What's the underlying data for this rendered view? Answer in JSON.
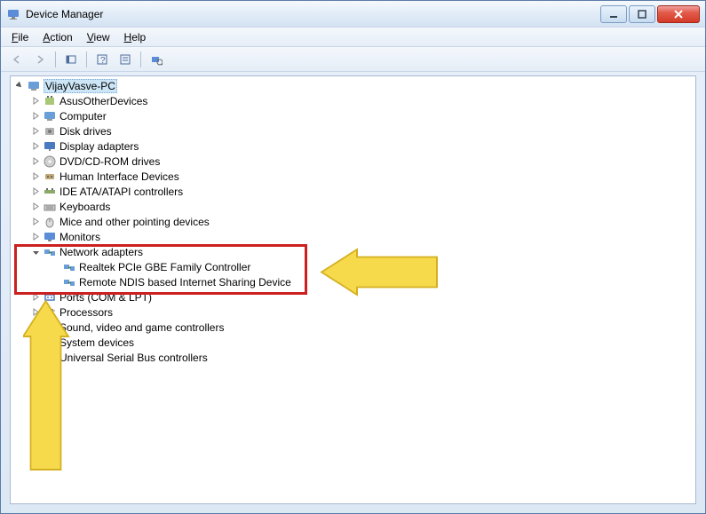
{
  "window": {
    "title": "Device Manager"
  },
  "menu": {
    "file": "File",
    "action": "Action",
    "view": "View",
    "help": "Help"
  },
  "tree": {
    "root": "VijayVasve-PC",
    "nodes": [
      {
        "label": "AsusOtherDevices",
        "expanded": false,
        "icon": "device"
      },
      {
        "label": "Computer",
        "expanded": false,
        "icon": "computer"
      },
      {
        "label": "Disk drives",
        "expanded": false,
        "icon": "disk"
      },
      {
        "label": "Display adapters",
        "expanded": false,
        "icon": "display"
      },
      {
        "label": "DVD/CD-ROM drives",
        "expanded": false,
        "icon": "cdrom"
      },
      {
        "label": "Human Interface Devices",
        "expanded": false,
        "icon": "hid"
      },
      {
        "label": "IDE ATA/ATAPI controllers",
        "expanded": false,
        "icon": "ide"
      },
      {
        "label": "Keyboards",
        "expanded": false,
        "icon": "keyboard"
      },
      {
        "label": "Mice and other pointing devices",
        "expanded": false,
        "icon": "mouse"
      },
      {
        "label": "Monitors",
        "expanded": false,
        "icon": "monitor"
      },
      {
        "label": "Network adapters",
        "expanded": true,
        "icon": "network",
        "children": [
          {
            "label": "Realtek PCIe GBE Family Controller",
            "icon": "network"
          },
          {
            "label": "Remote NDIS based Internet Sharing Device",
            "icon": "network"
          }
        ]
      },
      {
        "label": "Ports (COM & LPT)",
        "expanded": false,
        "icon": "port"
      },
      {
        "label": "Processors",
        "expanded": false,
        "icon": "cpu"
      },
      {
        "label": "Sound, video and game controllers",
        "expanded": false,
        "icon": "sound"
      },
      {
        "label": "System devices",
        "expanded": false,
        "icon": "system"
      },
      {
        "label": "Universal Serial Bus controllers",
        "expanded": false,
        "icon": "usb"
      }
    ]
  }
}
